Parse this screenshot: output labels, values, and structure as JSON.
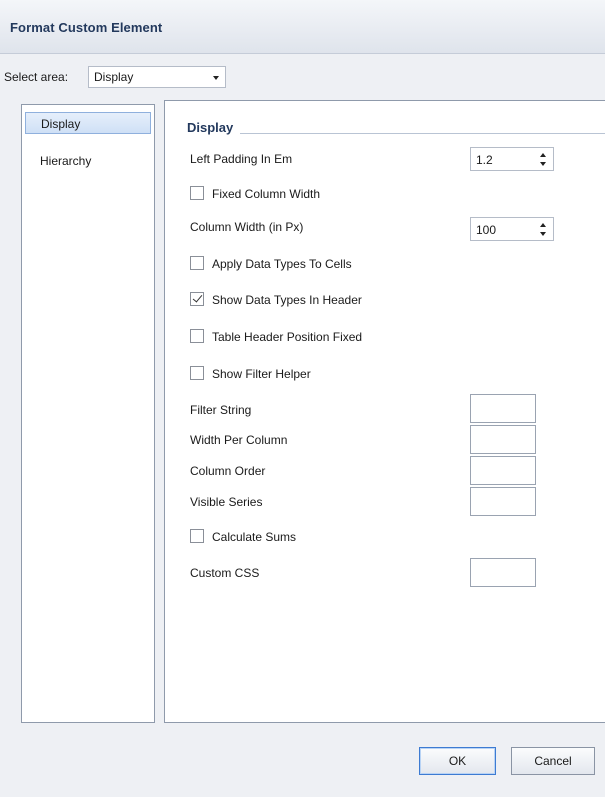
{
  "dialog": {
    "title": "Format Custom Element"
  },
  "select_area": {
    "label": "Select area:",
    "value": "Display"
  },
  "nav": {
    "items": [
      {
        "label": "Display",
        "selected": true
      },
      {
        "label": "Hierarchy",
        "selected": false
      }
    ]
  },
  "section": {
    "title": "Display"
  },
  "fields": {
    "left_padding": {
      "label": "Left Padding In Em",
      "value": "1.2"
    },
    "fixed_column_width": {
      "label": "Fixed Column Width",
      "checked": false
    },
    "column_width": {
      "label": "Column Width (in Px)",
      "value": "100"
    },
    "apply_data_types": {
      "label": "Apply Data Types To Cells",
      "checked": false
    },
    "show_data_types": {
      "label": "Show Data Types In Header",
      "checked": true
    },
    "table_header_fixed": {
      "label": "Table Header Position Fixed",
      "checked": false
    },
    "show_filter_helper": {
      "label": "Show Filter Helper",
      "checked": false
    },
    "filter_string": {
      "label": "Filter String",
      "value": ""
    },
    "width_per_column": {
      "label": "Width Per Column",
      "value": ""
    },
    "column_order": {
      "label": "Column Order",
      "value": ""
    },
    "visible_series": {
      "label": "Visible Series",
      "value": ""
    },
    "calculate_sums": {
      "label": "Calculate Sums",
      "checked": false
    },
    "custom_css": {
      "label": "Custom CSS",
      "value": ""
    }
  },
  "buttons": {
    "ok": "OK",
    "cancel": "Cancel"
  },
  "colors": {
    "title_text": "#23395d",
    "selected_item": "#cfe0f6",
    "default_button_border": "#3d7bd2"
  }
}
